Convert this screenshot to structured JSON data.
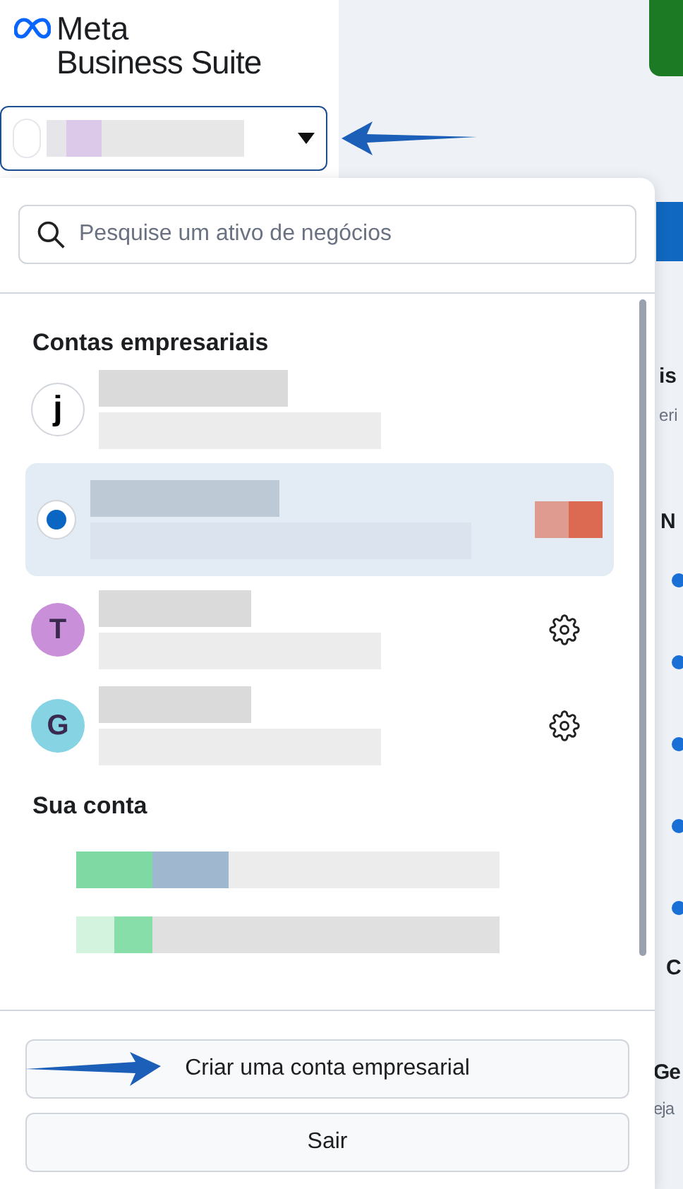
{
  "header": {
    "brand": "Meta",
    "product": "Business Suite"
  },
  "account_selector": {
    "expanded": true
  },
  "search": {
    "placeholder": "Pesquise um ativo de negócios"
  },
  "business_section": {
    "title": "Contas empresariais",
    "items": [
      {
        "kind": "logo",
        "letter": "j",
        "selected": false,
        "settings": false
      },
      {
        "kind": "radio",
        "selected": true,
        "settings": false
      },
      {
        "kind": "letter",
        "letter": "T",
        "color": "#c98fd8",
        "selected": false,
        "settings": true
      },
      {
        "kind": "letter",
        "letter": "G",
        "color": "#86d3e3",
        "selected": false,
        "settings": true
      }
    ]
  },
  "personal_section": {
    "title": "Sua conta"
  },
  "buttons": [
    {
      "label": "Criar uma conta empresarial",
      "annotated": true
    },
    {
      "label": "Sair",
      "annotated": false
    }
  ],
  "background_texts": [
    {
      "text": "is",
      "kind": "heading"
    },
    {
      "text": "eri",
      "kind": "sub"
    },
    {
      "text": "N",
      "kind": "heading"
    },
    {
      "text": "C",
      "kind": "heading"
    },
    {
      "text": "Ge",
      "kind": "heading"
    },
    {
      "text": "eja",
      "kind": "sub"
    }
  ]
}
